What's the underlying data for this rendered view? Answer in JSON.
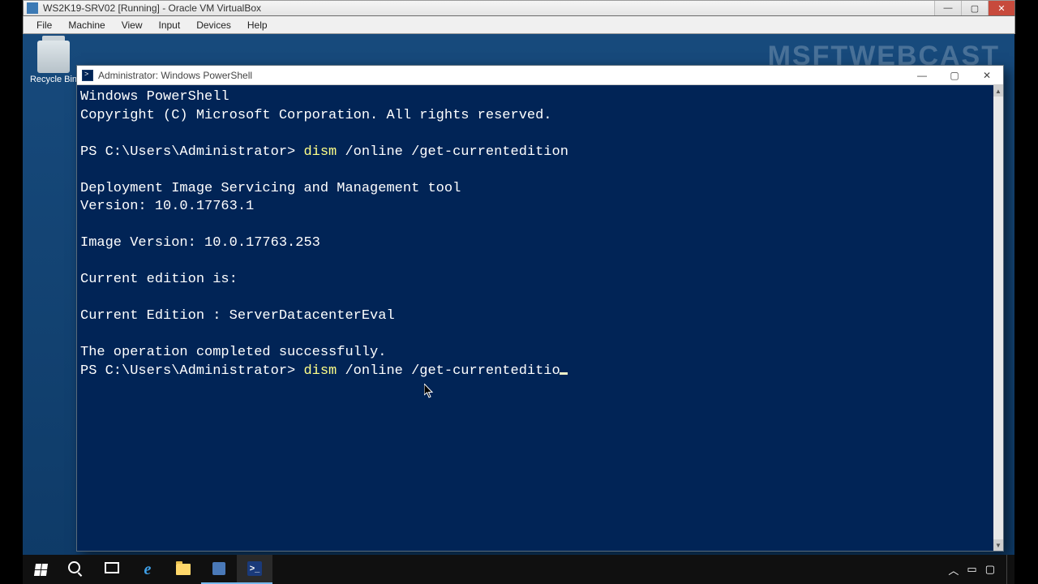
{
  "outer_window": {
    "title": "WS2K19-SRV02 [Running] - Oracle VM VirtualBox",
    "menu": [
      "File",
      "Machine",
      "View",
      "Input",
      "Devices",
      "Help"
    ]
  },
  "desktop": {
    "recycle_bin_label": "Recycle Bin",
    "watermark": "MSFTWEBCAST"
  },
  "ps_window": {
    "title": "Administrator: Windows PowerShell",
    "lines": {
      "l1": "Windows PowerShell",
      "l2": "Copyright (C) Microsoft Corporation. All rights reserved.",
      "blank": "",
      "prompt1_pre": "PS C:\\Users\\Administrator> ",
      "prompt1_cmd": "dism",
      "prompt1_args": " /online /get-currentedition",
      "l3": "Deployment Image Servicing and Management tool",
      "l4": "Version: 10.0.17763.1",
      "l5": "Image Version: 10.0.17763.253",
      "l6": "Current edition is:",
      "l7": "Current Edition : ServerDatacenterEval",
      "l8": "The operation completed successfully.",
      "prompt2_pre": "PS C:\\Users\\Administrator> ",
      "prompt2_cmd": "dism",
      "prompt2_args": " /online /get-currenteditio"
    }
  },
  "taskbar": {
    "items": {
      "start": "start-button",
      "search": "search-button",
      "taskview": "task-view-button",
      "ie": "internet-explorer",
      "folder": "file-explorer",
      "server": "server-manager",
      "powershell": "powershell"
    }
  }
}
